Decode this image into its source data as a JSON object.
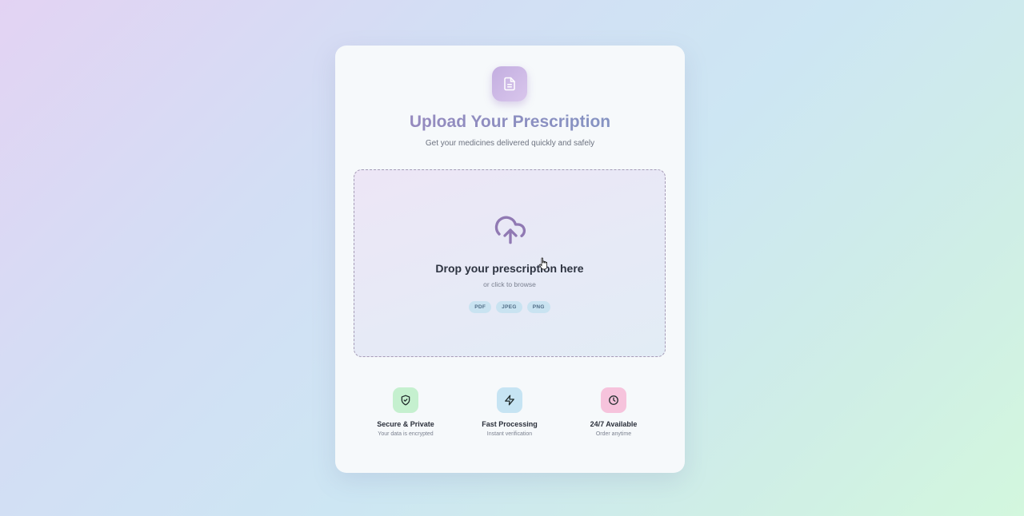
{
  "header": {
    "icon": "document-icon",
    "title": "Upload Your Prescription",
    "subtitle": "Get your medicines delivered quickly and safely"
  },
  "dropzone": {
    "icon": "cloud-upload-icon",
    "title": "Drop your prescription here",
    "subtitle": "or click to browse",
    "formats": [
      "PDF",
      "JPEG",
      "PNG"
    ]
  },
  "features": [
    {
      "icon": "shield-check-icon",
      "title": "Secure & Private",
      "subtitle": "Your data is encrypted",
      "color": "#c5f0cf"
    },
    {
      "icon": "lightning-icon",
      "title": "Fast Processing",
      "subtitle": "Instant verification",
      "color": "#c6e4f3"
    },
    {
      "icon": "clock-icon",
      "title": "24/7 Available",
      "subtitle": "Order anytime",
      "color": "#f6c3dc"
    }
  ],
  "colors": {
    "accent": "#9b86bd",
    "accent_blue": "#7f97c4",
    "chip_bg": "#c9e3f1"
  }
}
